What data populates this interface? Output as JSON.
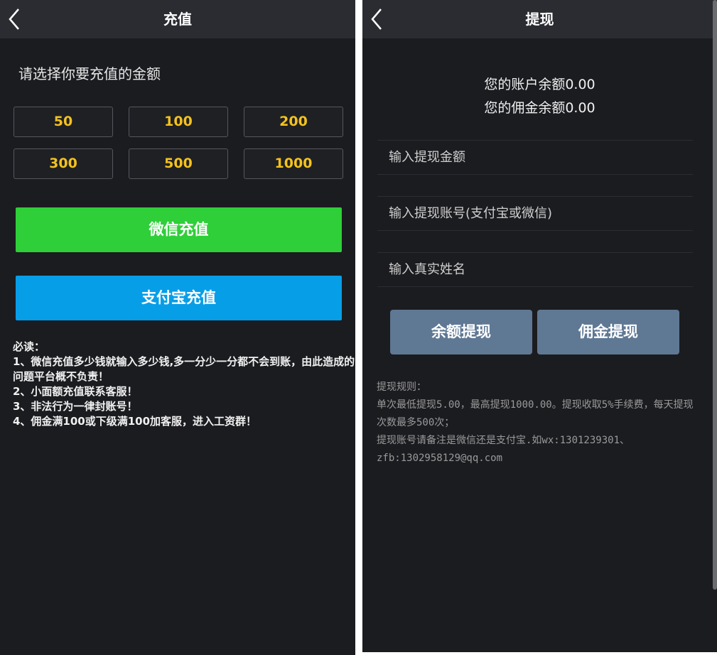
{
  "recharge": {
    "title": "充值",
    "prompt": "请选择你要充值的金额",
    "amounts": [
      "50",
      "100",
      "200",
      "300",
      "500",
      "1000"
    ],
    "wechat_button": "微信充值",
    "alipay_button": "支付宝充值",
    "notice_lines": [
      "必读：",
      "1、微信充值多少钱就输入多少钱,多一分少一分都不会到账，由此造成的问题平台概不负责！",
      "2、小面额充值联系客服！",
      "3、非法行为一律封账号！",
      "4、佣金满100或下级满100加客服，进入工资群！"
    ]
  },
  "withdraw": {
    "title": "提现",
    "account_balance": "您的账户余额0.00",
    "commission_balance": "您的佣金余额0.00",
    "amount_placeholder": "输入提现金额",
    "account_placeholder": "输入提现账号(支付宝或微信)",
    "name_placeholder": "输入真实姓名",
    "balance_withdraw_button": "余额提现",
    "commission_withdraw_button": "佣金提现",
    "rules_title": "提现规则：",
    "rules_line1": "单次最低提现5.00，最高提现1000.00。提现收取5%手续费，每天提现次数最多500次；",
    "rules_line2": "提现账号请备注是微信还是支付宝.如wx:1301239301、zfb:1302958129@qq.com"
  },
  "colors": {
    "background": "#1b1c20",
    "header": "#2b2c31",
    "amount_text": "#f4c21d",
    "wechat_green": "#2ecf38",
    "alipay_blue": "#079ee8",
    "withdraw_button": "#5f7894"
  },
  "icons": {
    "back": "chevron-left-icon"
  }
}
